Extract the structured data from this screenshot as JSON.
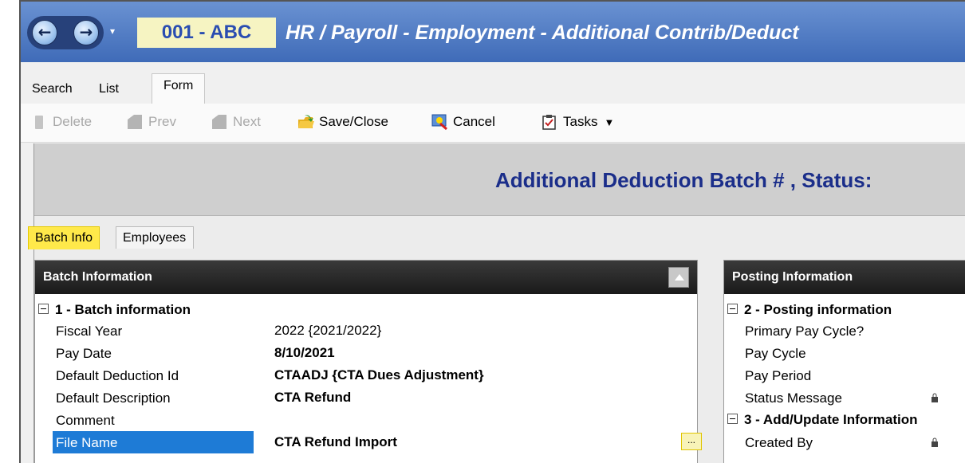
{
  "window": {
    "nav_back": "←",
    "nav_forward": "→",
    "nav_dropdown": "▾",
    "entity": "001 - ABC",
    "title": "HR / Payroll - Employment - Additional Contrib/Deduct"
  },
  "mode_tabs": [
    "Search",
    "List",
    "Form"
  ],
  "toolbar": {
    "delete": "Delete",
    "prev": "Prev",
    "next": "Next",
    "save_close": "Save/Close",
    "cancel": "Cancel",
    "tasks": "Tasks",
    "tasks_arrow": "▼"
  },
  "header": {
    "title": "Additional Deduction Batch # , Status:"
  },
  "subtabs": [
    "Batch Info",
    "Employees"
  ],
  "batch_panel": {
    "title": "Batch Information",
    "section_title": "1 - Batch information",
    "rows": [
      {
        "label": "Fiscal Year",
        "value": "2022 {2021/2022}"
      },
      {
        "label": "Pay Date",
        "value": "8/10/2021"
      },
      {
        "label": "Default Deduction Id",
        "value": "CTAADJ {CTA Dues Adjustment}"
      },
      {
        "label": "Default Description",
        "value": "CTA Refund"
      },
      {
        "label": "Comment",
        "value": ""
      },
      {
        "label": "File Name",
        "value": "CTA Refund Import"
      }
    ],
    "ellipsis": "..."
  },
  "posting_panel": {
    "title": "Posting Information",
    "section2": "2 - Posting information",
    "rows2": [
      "Primary Pay Cycle?",
      "Pay Cycle",
      "Pay Period",
      "Status Message"
    ],
    "section3": "3 - Add/Update Information",
    "rows3": [
      "Created By"
    ]
  },
  "colors": {
    "title_bar": "#4a78c4",
    "highlight_yellow": "#ffe94a",
    "selection_blue": "#1e7bd6",
    "header_text": "#1b2e8a"
  }
}
